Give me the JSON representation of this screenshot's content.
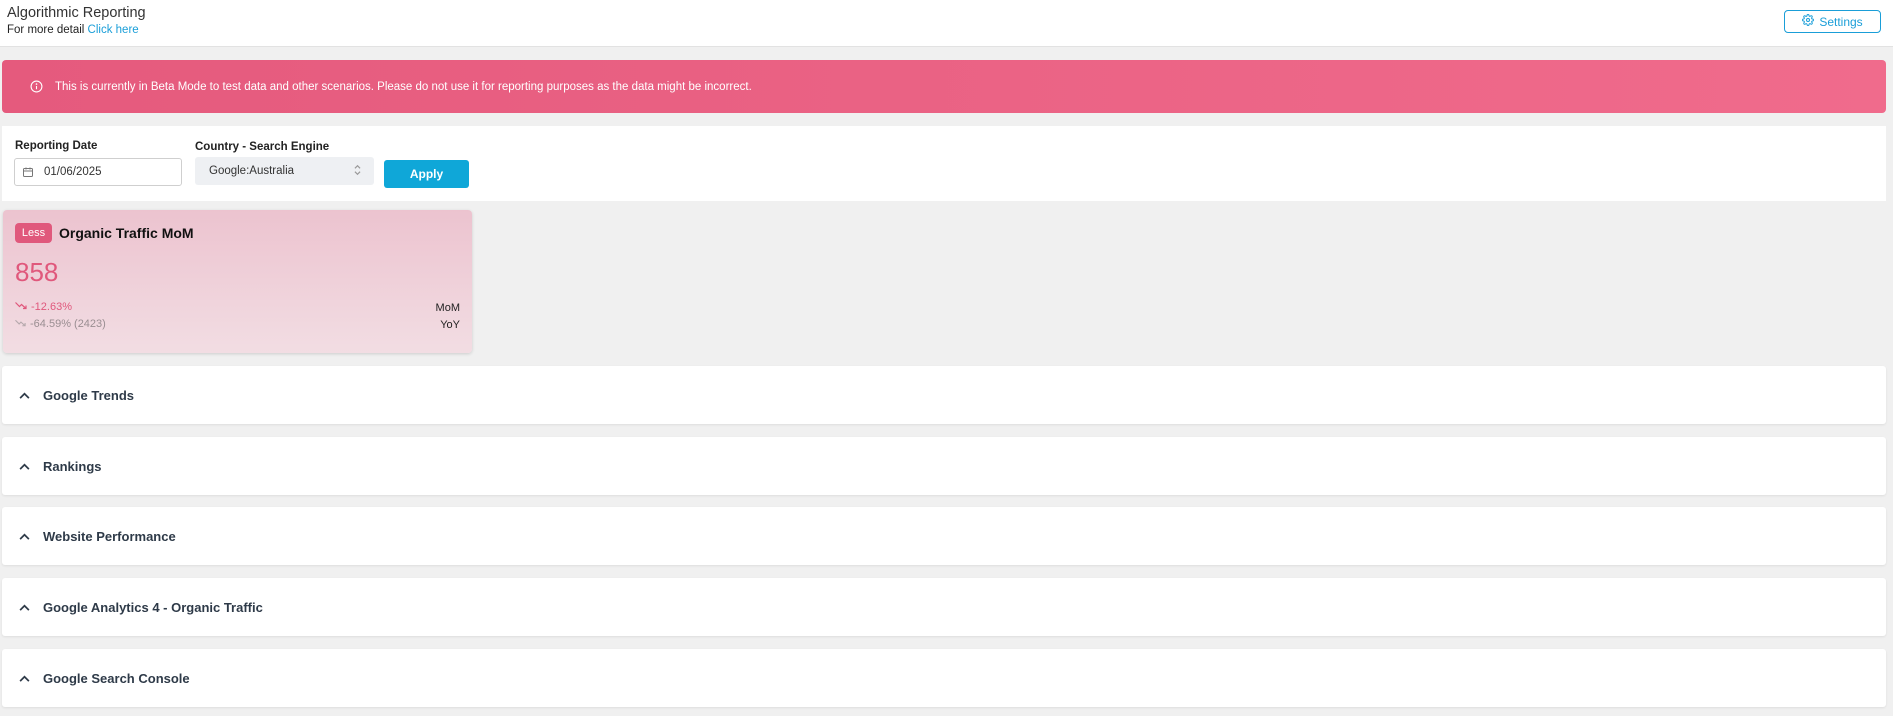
{
  "header": {
    "title": "Algorithmic Reporting",
    "detail_prefix": "For more detail",
    "detail_link": "Click here",
    "settings_label": "Settings"
  },
  "banner": {
    "message": "This is currently in Beta Mode to test data and other scenarios. Please do not use it for reporting purposes as the data might be incorrect.",
    "color": "#ee6688"
  },
  "filters": {
    "date_label": "Reporting Date",
    "date_value": "01/06/2025",
    "country_label": "Country - Search Engine",
    "country_value": "Google:Australia",
    "apply_label": "Apply"
  },
  "metric_card": {
    "badge": "Less",
    "title": "Organic Traffic MoM",
    "value": "858",
    "mom_change": "-12.63%",
    "mom_label": "MoM",
    "yoy_change": "-64.59% (2423)",
    "yoy_label": "YoY",
    "accent_color": "#e0587c"
  },
  "sections": [
    {
      "label": "Google Trends"
    },
    {
      "label": "Rankings"
    },
    {
      "label": "Website Performance"
    },
    {
      "label": "Google Analytics 4 - Organic Traffic"
    },
    {
      "label": "Google Search Console"
    }
  ],
  "icons": {
    "settings": "gear-icon",
    "info": "info-icon",
    "date": "calendar-icon",
    "select": "sort-arrows-icon",
    "trend": "trending-down-icon",
    "section": "chevron-up-icon"
  },
  "accent_color": "#0fa7d8"
}
